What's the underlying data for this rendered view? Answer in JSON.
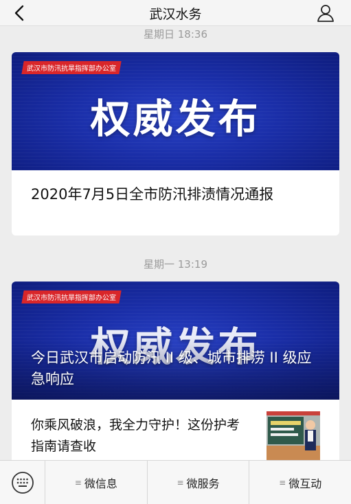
{
  "header": {
    "title": "武汉水务",
    "back_icon": "back-chevron-icon",
    "profile_icon": "person-icon"
  },
  "messages": [
    {
      "time": "星期日 18:36",
      "banner": {
        "tag": "武汉市防汛抗旱指挥部办公室",
        "headline": "权威发布"
      },
      "title": "2020年7月5日全市防汛排渍情况通报"
    },
    {
      "time": "星期一 13:19",
      "banner": {
        "tag": "武汉市防汛抗旱指挥部办公室",
        "headline": "权威发布"
      },
      "title": "今日武汉市启动防汛 II 级、城市排涝 II 级应急响应",
      "sub_items": [
        {
          "title": "你乘风破浪，我全力守护！这份护考指南请查收"
        }
      ]
    }
  ],
  "bottom_menu": {
    "keyboard_icon": "keyboard-icon",
    "items": [
      {
        "label": "微信息",
        "icon": "menu-lines-icon"
      },
      {
        "label": "微服务",
        "icon": "menu-lines-icon"
      },
      {
        "label": "微互动",
        "icon": "menu-lines-icon"
      }
    ]
  },
  "colors": {
    "banner_blue": "#1a2ea8",
    "tag_red": "#d9262a",
    "time_gray": "#9a9a9a"
  }
}
